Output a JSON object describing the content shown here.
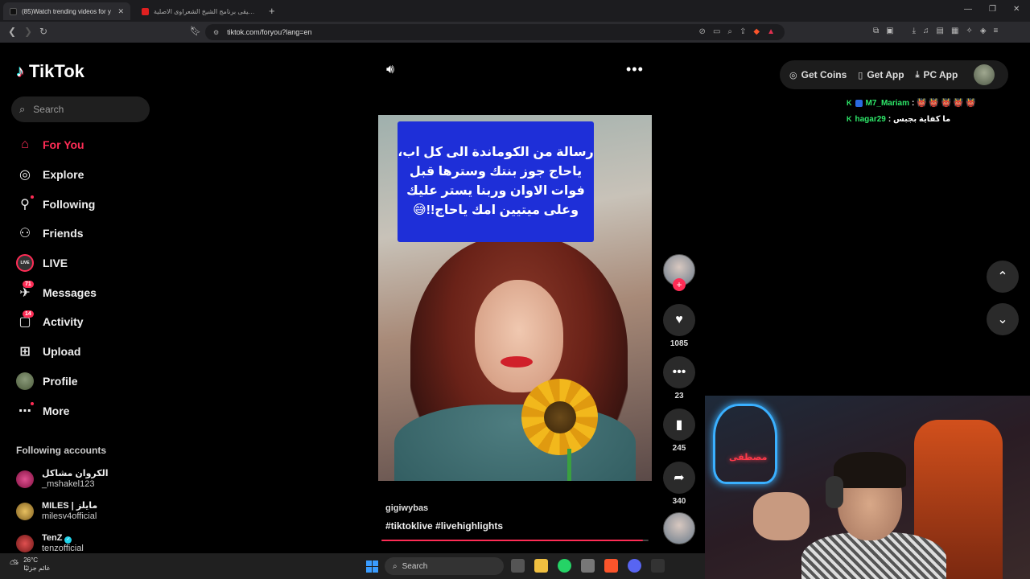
{
  "browser": {
    "tabs": [
      {
        "title": "(85)Watch trending videos for y",
        "favicon_color": "#000000",
        "active": true
      },
      {
        "title": "موسيقى برنامج الشيخ الشعراوى الاصلية",
        "favicon_color": "#ff0000",
        "active": false
      }
    ],
    "new_tab": "+",
    "url": "tiktok.com/foryou?lang=en",
    "window_controls": [
      "—",
      "❐",
      "✕"
    ]
  },
  "sidebar": {
    "logo": "TikTok",
    "search_placeholder": "Search",
    "items": [
      {
        "label": "For You",
        "icon": "home-icon",
        "active": true
      },
      {
        "label": "Explore",
        "icon": "compass-icon"
      },
      {
        "label": "Following",
        "icon": "following-icon",
        "dot": true
      },
      {
        "label": "Friends",
        "icon": "friends-icon"
      },
      {
        "label": "LIVE",
        "icon": "live-icon"
      },
      {
        "label": "Messages",
        "icon": "messages-icon",
        "badge": "71"
      },
      {
        "label": "Activity",
        "icon": "activity-icon",
        "badge": "14"
      },
      {
        "label": "Upload",
        "icon": "upload-icon"
      },
      {
        "label": "Profile",
        "icon": "profile-icon"
      },
      {
        "label": "More",
        "icon": "more-icon",
        "dot": true
      }
    ],
    "following_title": "Following accounts",
    "following": [
      {
        "name": "الكروان مشاكل",
        "user": "_mshakel123",
        "color": "#c0306a"
      },
      {
        "name": "MILES | مايلز",
        "user": "milesv4official",
        "color": "#c8a030"
      },
      {
        "name": "TenZ",
        "user": "tenzofficial",
        "color": "#c03030",
        "verified": true
      }
    ]
  },
  "video": {
    "caption_lines": [
      "رسالة من الكوماندة الى كل اب،",
      "ياحاج جوز بنتك وسترها قبل",
      "فوات الاوان وربنا يستر عليك",
      "وعلى ميتيين امك ياحاج!!😅"
    ],
    "username": "gigiwybas",
    "hashtags": "#tiktoklive  #livehighlights",
    "progress": 0.98
  },
  "actions": {
    "likes": "1085",
    "comments": "23",
    "saves": "245",
    "shares": "340"
  },
  "topbar": {
    "get_coins": "Get Coins",
    "get_app": "Get App",
    "pc_app": "PC App"
  },
  "chat": [
    {
      "name": "M7_Mariam",
      "msg": ": 👹 👹 👹 👹 👹"
    },
    {
      "name": "hagar29",
      "msg": ": ما كفاية بجبس"
    }
  ],
  "webcam": {
    "neon_text": "مصطفى"
  },
  "taskbar": {
    "temperature": "26°C",
    "weather_text": "غائم جزئيًا",
    "search": "Search"
  }
}
